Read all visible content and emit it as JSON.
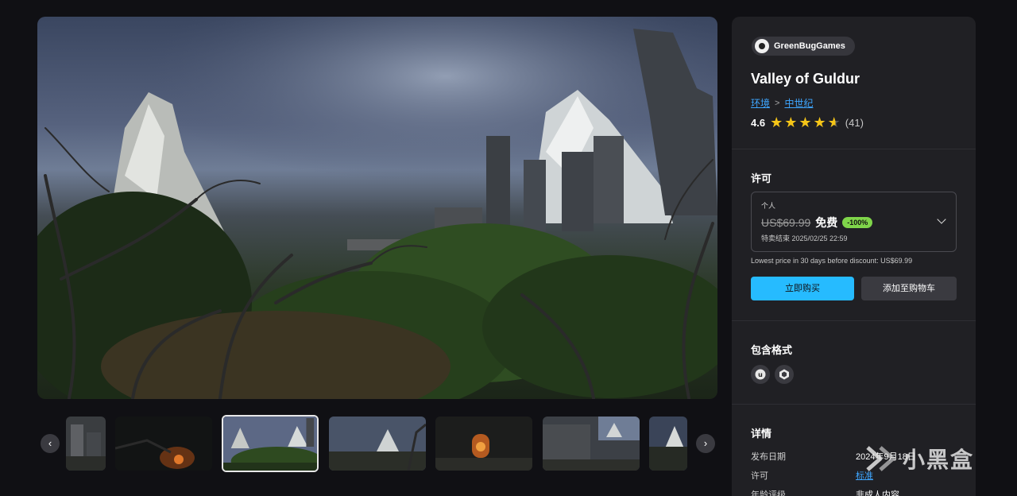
{
  "gallery": {
    "prev_label": "‹",
    "next_label": "›",
    "thumb_count": 7,
    "active_thumb": 2
  },
  "product": {
    "publisher": "GreenBugGames",
    "title": "Valley of Guldur",
    "breadcrumbs": [
      "环境",
      "中世纪"
    ],
    "rating": "4.6",
    "rating_stars": 4.6,
    "rating_count": "(41)"
  },
  "license": {
    "heading": "许可",
    "type": "个人",
    "original_price": "US$69.99",
    "price": "免费",
    "discount": "-100%",
    "sale_end": "特卖结束 2025/02/25 22:59",
    "lowest_price_note": "Lowest price in 30 days before discount: US$69.99"
  },
  "actions": {
    "buy_label": "立即购买",
    "cart_label": "添加至购物车"
  },
  "formats": {
    "heading": "包含格式",
    "items": [
      "unreal-engine-icon",
      "unity-icon"
    ]
  },
  "details": {
    "heading": "详情",
    "rows": [
      {
        "label": "发布日期",
        "value": "2024年9月18日"
      },
      {
        "label": "许可",
        "value": "标准"
      },
      {
        "label": "年龄评级",
        "value": "非成人内容"
      }
    ]
  },
  "watermark": {
    "text": "小黑盒"
  },
  "colors": {
    "background": "#101014",
    "panel": "#202024",
    "accent": "#26bbff",
    "discount": "#7fd54a",
    "star": "#f5c518",
    "link": "#3ea6ff"
  }
}
